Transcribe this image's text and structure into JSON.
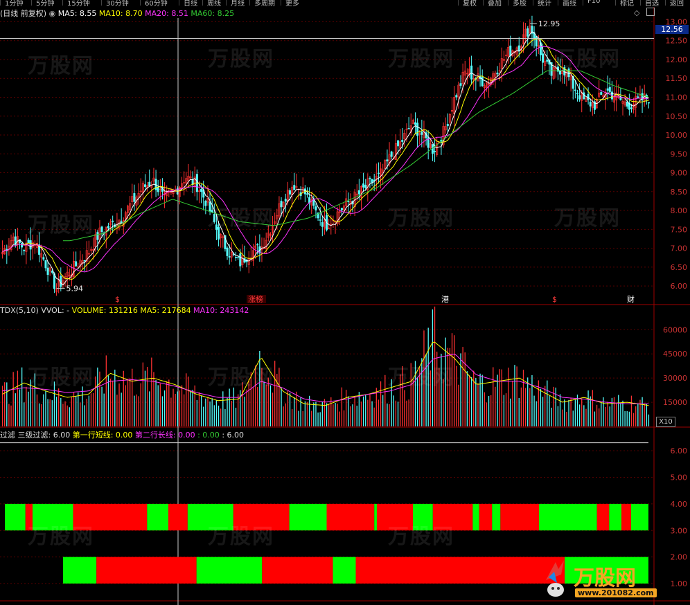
{
  "toolbar": {
    "periods": [
      "1分钟",
      "5分钟",
      "15分钟",
      "30分钟",
      "60分钟",
      "日线",
      "周线",
      "月线",
      "多周期",
      "更多"
    ],
    "buttons": [
      "复权",
      "叠加",
      "多股",
      "统计",
      "画线",
      "F10",
      "标记",
      "自选",
      "返回"
    ]
  },
  "main_info": {
    "indicator_label": "(日线 前复权)",
    "ma5": "MA5: 8.55",
    "ma10": "MA10: 8.70",
    "ma20": "MA20: 8.51",
    "ma60": "MA60: 8.25"
  },
  "vol_info": {
    "label": "TDX(5,10)",
    "wvol": "VVOL: -",
    "volume": "VOLUME: 131216",
    "ma5": "MA5: 217684",
    "ma10": "MA10: 243142"
  },
  "filter_info": {
    "label": "过滤",
    "level3": "三级过滤: 6.00",
    "line1": "第一行短线: 0.00",
    "line2": "第二行长线: 0.00",
    "v1": ": 0.00",
    "v2": ": 6.00"
  },
  "price_tag": "12.56",
  "unit_tag": "X10",
  "annotations": {
    "high": "12.95",
    "low": "5.94",
    "events": [
      {
        "label": "$",
        "color": "#ff3b3b"
      },
      {
        "label": "涨榜",
        "color": "#ff3b3b"
      },
      {
        "label": "港",
        "color": "#ffffff"
      },
      {
        "label": "$",
        "color": "#ff3b3b"
      },
      {
        "label": "财",
        "color": "#ffffff"
      }
    ]
  },
  "watermark": {
    "brand": "万股网",
    "url": "www.201082.com"
  },
  "chart_data": {
    "type": "line",
    "price_axis": {
      "ticks": [
        "13.00",
        "12.50",
        "12.00",
        "11.50",
        "11.00",
        "10.50",
        "10.00",
        "9.50",
        "9.00",
        "8.50",
        "8.00",
        "7.50",
        "7.00",
        "6.50",
        "6.00"
      ],
      "ylim": [
        5.8,
        13.1
      ]
    },
    "volume_axis": {
      "ticks": [
        "60000",
        "45000",
        "30000",
        "15000"
      ],
      "ylim": [
        0,
        67000
      ]
    },
    "filter_axis": {
      "ticks": [
        "6.00",
        "5.00",
        "4.00",
        "3.00",
        "2.00",
        "1.00"
      ],
      "ylim": [
        0.4,
        6.5
      ]
    },
    "series": [
      {
        "name": "MA5",
        "color": "#ffffff"
      },
      {
        "name": "MA10",
        "color": "#ffff00"
      },
      {
        "name": "MA20",
        "color": "#ff33ff"
      },
      {
        "name": "MA60",
        "color": "#33cc33"
      }
    ],
    "close_anchors": [
      6.9,
      7.3,
      7.0,
      7.2,
      6.6,
      5.94,
      6.3,
      6.6,
      6.9,
      7.4,
      7.6,
      7.8,
      8.2,
      8.6,
      8.8,
      8.3,
      8.5,
      8.9,
      8.7,
      8.2,
      7.4,
      6.9,
      6.6,
      6.9,
      7.0,
      7.6,
      8.3,
      8.7,
      8.5,
      8.0,
      7.6,
      7.9,
      8.2,
      8.4,
      8.7,
      8.9,
      9.4,
      9.8,
      10.3,
      10.0,
      9.6,
      10.1,
      11.0,
      11.7,
      11.5,
      11.4,
      11.8,
      12.2,
      12.4,
      12.9,
      12.1,
      11.6,
      11.8,
      11.3,
      10.9,
      10.8,
      11.2,
      11.0,
      10.8,
      10.9,
      11.0
    ],
    "ma60_anchors": [
      7.5,
      7.2,
      7.2,
      7.4,
      7.9,
      8.3,
      8.0,
      7.7,
      7.6,
      7.8,
      8.2,
      8.6,
      9.2,
      9.9,
      10.6,
      11.1,
      11.7,
      11.7,
      11.3,
      11.0
    ],
    "volume_ma5_anchors": [
      20000,
      27000,
      22000,
      18000,
      20000,
      33000,
      28000,
      30000,
      26000,
      20000,
      16000,
      17000,
      43000,
      22000,
      14000,
      13000,
      18000,
      20000,
      24000,
      28000,
      53000,
      42000,
      26000,
      28000,
      30000,
      22000,
      15000,
      18000,
      14000,
      15000,
      13000
    ],
    "volume_ma10_anchors": [
      22000,
      24000,
      23000,
      21000,
      22000,
      28000,
      29000,
      28000,
      25000,
      21000,
      18000,
      18000,
      28000,
      24000,
      17000,
      15000,
      17000,
      20000,
      22000,
      26000,
      42000,
      45000,
      32000,
      28000,
      28000,
      24000,
      18000,
      17000,
      15000,
      14000,
      14000
    ],
    "short_line_segments": [
      {
        "from": 0.0,
        "to": 0.032,
        "color": "#00ff00"
      },
      {
        "from": 0.032,
        "to": 0.043,
        "color": "#ff0000"
      },
      {
        "from": 0.043,
        "to": 0.106,
        "color": "#00ff00"
      },
      {
        "from": 0.106,
        "to": 0.221,
        "color": "#ff0000"
      },
      {
        "from": 0.221,
        "to": 0.254,
        "color": "#00ff00"
      },
      {
        "from": 0.254,
        "to": 0.284,
        "color": "#ff0000"
      },
      {
        "from": 0.284,
        "to": 0.355,
        "color": "#00ff00"
      },
      {
        "from": 0.355,
        "to": 0.442,
        "color": "#ff0000"
      },
      {
        "from": 0.442,
        "to": 0.5,
        "color": "#00ff00"
      },
      {
        "from": 0.5,
        "to": 0.574,
        "color": "#ff0000"
      },
      {
        "from": 0.574,
        "to": 0.578,
        "color": "#00ff00"
      },
      {
        "from": 0.578,
        "to": 0.634,
        "color": "#ff0000"
      },
      {
        "from": 0.634,
        "to": 0.665,
        "color": "#00ff00"
      },
      {
        "from": 0.665,
        "to": 0.727,
        "color": "#ff0000"
      },
      {
        "from": 0.727,
        "to": 0.737,
        "color": "#00ff00"
      },
      {
        "from": 0.737,
        "to": 0.757,
        "color": "#ff0000"
      },
      {
        "from": 0.757,
        "to": 0.77,
        "color": "#00ff00"
      },
      {
        "from": 0.77,
        "to": 0.83,
        "color": "#ff0000"
      },
      {
        "from": 0.83,
        "to": 0.92,
        "color": "#00ff00"
      },
      {
        "from": 0.92,
        "to": 0.939,
        "color": "#ff0000"
      },
      {
        "from": 0.939,
        "to": 0.958,
        "color": "#00ff00"
      },
      {
        "from": 0.958,
        "to": 0.973,
        "color": "#ff0000"
      },
      {
        "from": 0.973,
        "to": 1.0,
        "color": "#00ff00"
      }
    ],
    "long_line_segments": [
      {
        "from": 0.0,
        "to": 0.057,
        "color": "#00ff00"
      },
      {
        "from": 0.057,
        "to": 0.228,
        "color": "#ff0000"
      },
      {
        "from": 0.228,
        "to": 0.34,
        "color": "#00ff00"
      },
      {
        "from": 0.34,
        "to": 0.461,
        "color": "#ff0000"
      },
      {
        "from": 0.461,
        "to": 0.5,
        "color": "#00ff00"
      },
      {
        "from": 0.5,
        "to": 0.857,
        "color": "#ff0000"
      },
      {
        "from": 0.857,
        "to": 1.0,
        "color": "#00ff00"
      }
    ]
  }
}
